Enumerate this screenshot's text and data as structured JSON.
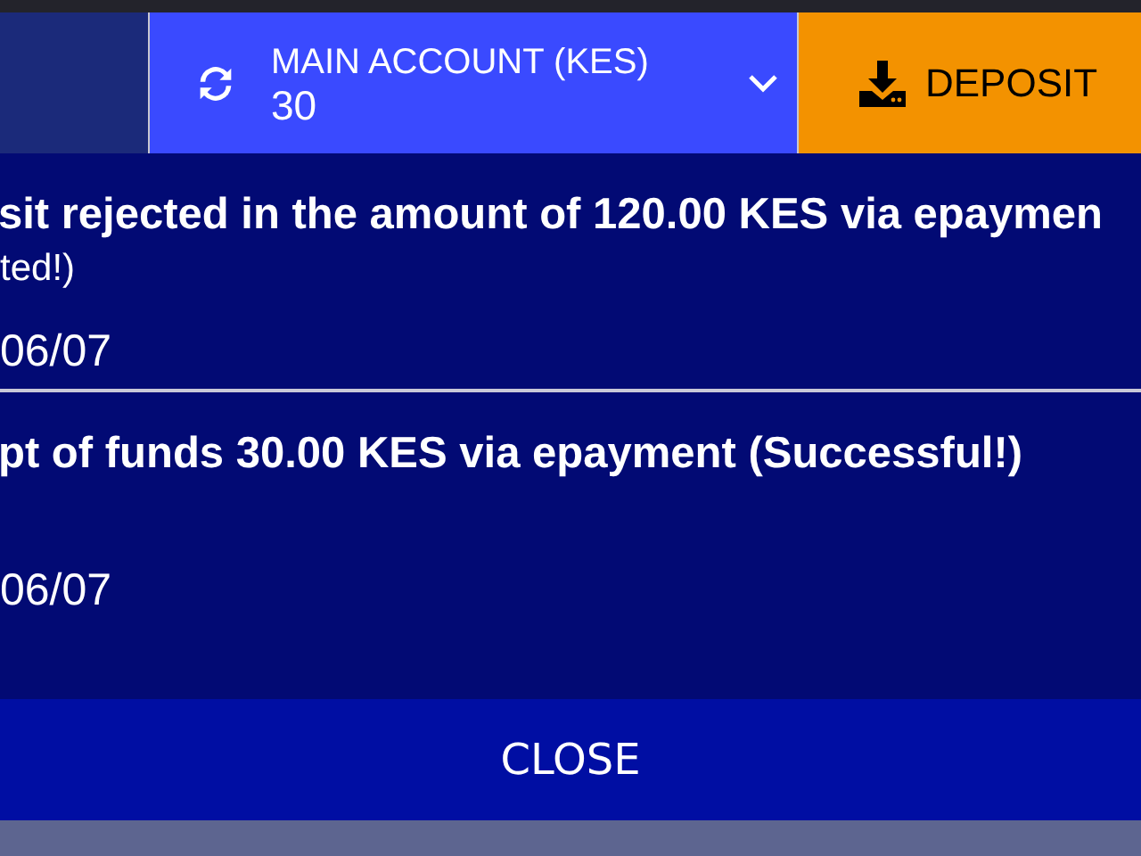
{
  "account": {
    "label": "MAIN ACCOUNT (KES)",
    "balance": "30"
  },
  "deposit": {
    "label": "DEPOSIT"
  },
  "notifications": [
    {
      "title": "sit rejected in the amount of 120.00 KES via epaymen",
      "title_2": "ted!)",
      "date": "06/07"
    },
    {
      "title": "pt of funds 30.00 KES via epayment (Successful!)",
      "date": "06/07"
    }
  ],
  "close_button": "CLOSE"
}
